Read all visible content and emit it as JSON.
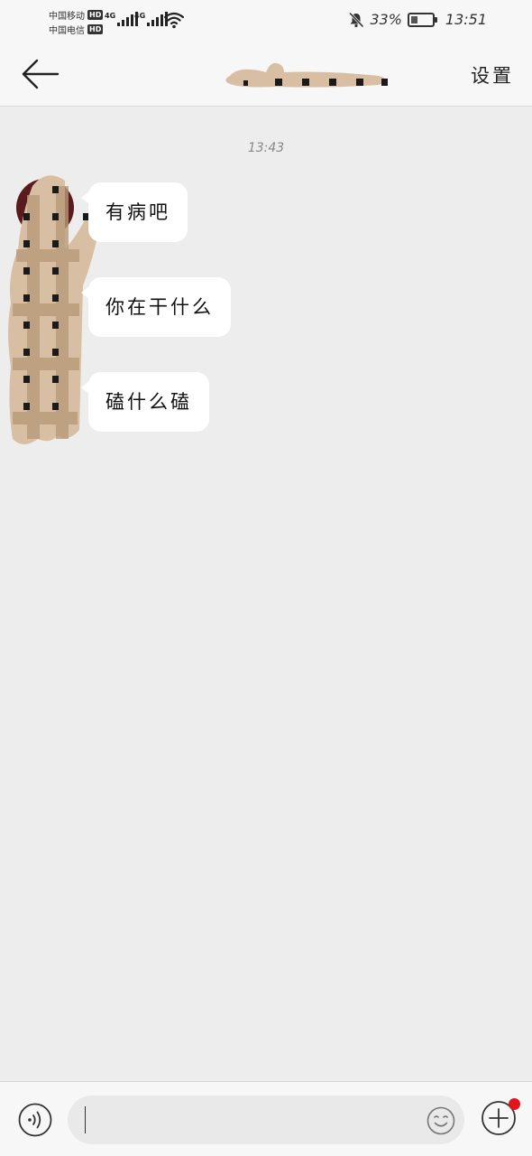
{
  "status_bar": {
    "carrier_1": "中国移动",
    "carrier_2": "中国电信",
    "hd_label": "HD",
    "network_1": "4G",
    "network_2": "4G",
    "battery_percent": "33%",
    "battery_level": 0.33,
    "time": "13:51",
    "icons": [
      "signal-icon",
      "wifi-icon",
      "mute-bell-icon",
      "battery-icon"
    ]
  },
  "header": {
    "back_icon": "arrow-left-icon",
    "title_redacted": true,
    "settings_label": "设置"
  },
  "chat": {
    "timestamp": "13:43",
    "avatar_redacted": true,
    "messages": [
      {
        "text": "有病吧"
      },
      {
        "text": "你在干什么"
      },
      {
        "text": "磕什么磕"
      }
    ]
  },
  "input_bar": {
    "voice_icon": "voice-icon",
    "emoji_icon": "emoji-icon",
    "plus_icon": "plus-circle-icon",
    "input_value": "",
    "has_notification_dot": true
  },
  "colors": {
    "background": "#ededed",
    "bubble": "#ffffff",
    "bar": "#f7f7f7",
    "notification_dot": "#e0161e",
    "redaction_tan": "#d8bfa3",
    "redaction_dark": "#1a1a1a"
  }
}
